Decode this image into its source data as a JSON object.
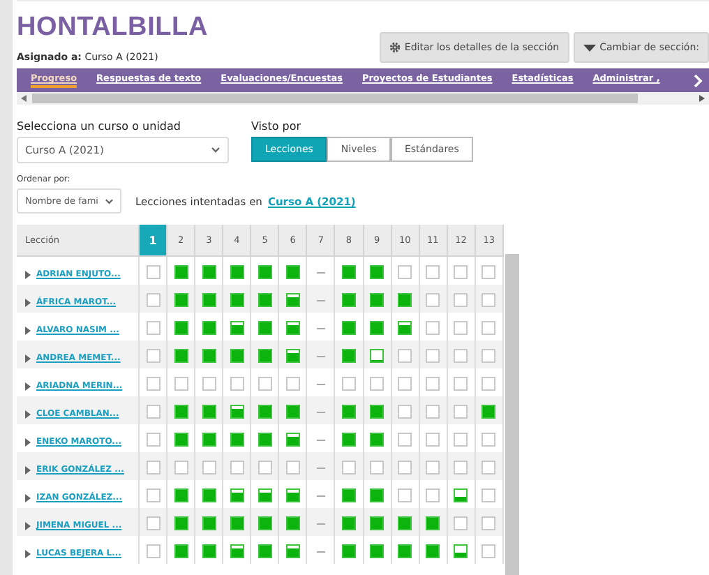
{
  "title": "HONTALBILLA",
  "assigned": {
    "label": "Asignado a:",
    "value": "Curso A (2021)"
  },
  "buttons": [
    {
      "kind": "gear",
      "label": "Editar los detalles de la sección"
    },
    {
      "kind": "caret",
      "label": "Cambiar de sección:"
    }
  ],
  "tabs": [
    {
      "label": "Progreso",
      "selected": true
    },
    {
      "label": "Respuestas de texto",
      "selected": false
    },
    {
      "label": "Evaluaciones/Encuestas",
      "selected": false
    },
    {
      "label": "Proyectos de Estudiantes",
      "selected": false
    },
    {
      "label": "Estadísticas",
      "selected": false
    },
    {
      "label": "Administrar ,",
      "selected": false
    }
  ],
  "course_select": {
    "label": "Selecciona un curso o unidad",
    "value": "Curso A (2021)"
  },
  "view_by": {
    "label": "Visto por",
    "options": [
      {
        "label": "Lecciones",
        "selected": true
      },
      {
        "label": "Niveles",
        "selected": false
      },
      {
        "label": "Estándares",
        "selected": false
      }
    ]
  },
  "sort": {
    "label": "Ordenar por:",
    "value": "Nombre de fami"
  },
  "attempted": {
    "text": "Lecciones intentadas en",
    "link": "Curso A (2021)"
  },
  "table": {
    "first_column": "Lección",
    "lessons": [
      {
        "label": "1",
        "selected": true
      },
      {
        "label": "2",
        "selected": false
      },
      {
        "label": "3",
        "selected": false
      },
      {
        "label": "4",
        "selected": false
      },
      {
        "label": "5",
        "selected": false
      },
      {
        "label": "6",
        "selected": false
      },
      {
        "label": "7",
        "selected": false
      },
      {
        "label": "8",
        "selected": false
      },
      {
        "label": "9",
        "selected": false
      },
      {
        "label": "10",
        "selected": false
      },
      {
        "label": "11",
        "selected": false
      },
      {
        "label": "12",
        "selected": false
      },
      {
        "label": "13",
        "selected": false
      }
    ],
    "rows": [
      {
        "name": "ADRIAN ENJUTO...",
        "cells": [
          {
            "kind": "empty"
          },
          {
            "kind": "full"
          },
          {
            "kind": "full"
          },
          {
            "kind": "full"
          },
          {
            "kind": "full"
          },
          {
            "kind": "full"
          },
          {
            "kind": "dash"
          },
          {
            "kind": "full"
          },
          {
            "kind": "full"
          },
          {
            "kind": "empty"
          },
          {
            "kind": "empty"
          },
          {
            "kind": "empty"
          },
          {
            "kind": "empty"
          }
        ]
      },
      {
        "name": "ÁFRICA MAROT...",
        "cells": [
          {
            "kind": "empty"
          },
          {
            "kind": "full"
          },
          {
            "kind": "full"
          },
          {
            "kind": "full"
          },
          {
            "kind": "full"
          },
          {
            "kind": "high"
          },
          {
            "kind": "dash"
          },
          {
            "kind": "full"
          },
          {
            "kind": "full"
          },
          {
            "kind": "full"
          },
          {
            "kind": "empty"
          },
          {
            "kind": "empty"
          },
          {
            "kind": "empty"
          }
        ]
      },
      {
        "name": "ALVARO NASIM ...",
        "cells": [
          {
            "kind": "empty"
          },
          {
            "kind": "full"
          },
          {
            "kind": "full"
          },
          {
            "kind": "high"
          },
          {
            "kind": "full"
          },
          {
            "kind": "high"
          },
          {
            "kind": "dash"
          },
          {
            "kind": "full"
          },
          {
            "kind": "full"
          },
          {
            "kind": "high"
          },
          {
            "kind": "empty"
          },
          {
            "kind": "empty"
          },
          {
            "kind": "empty"
          }
        ]
      },
      {
        "name": "ANDREA MEMET...",
        "cells": [
          {
            "kind": "empty"
          },
          {
            "kind": "full"
          },
          {
            "kind": "full"
          },
          {
            "kind": "full"
          },
          {
            "kind": "full"
          },
          {
            "kind": "high"
          },
          {
            "kind": "dash"
          },
          {
            "kind": "full"
          },
          {
            "kind": "low"
          },
          {
            "kind": "empty"
          },
          {
            "kind": "empty"
          },
          {
            "kind": "empty"
          },
          {
            "kind": "empty"
          }
        ]
      },
      {
        "name": "ARIADNA MERIN...",
        "cells": [
          {
            "kind": "empty"
          },
          {
            "kind": "empty"
          },
          {
            "kind": "empty"
          },
          {
            "kind": "empty"
          },
          {
            "kind": "empty"
          },
          {
            "kind": "empty"
          },
          {
            "kind": "dash"
          },
          {
            "kind": "empty"
          },
          {
            "kind": "empty"
          },
          {
            "kind": "empty"
          },
          {
            "kind": "empty"
          },
          {
            "kind": "empty"
          },
          {
            "kind": "empty"
          }
        ]
      },
      {
        "name": "CLOE CAMBLAN...",
        "cells": [
          {
            "kind": "empty"
          },
          {
            "kind": "full"
          },
          {
            "kind": "full"
          },
          {
            "kind": "high"
          },
          {
            "kind": "full"
          },
          {
            "kind": "full"
          },
          {
            "kind": "dash"
          },
          {
            "kind": "full"
          },
          {
            "kind": "full"
          },
          {
            "kind": "empty"
          },
          {
            "kind": "empty"
          },
          {
            "kind": "empty"
          },
          {
            "kind": "full"
          }
        ]
      },
      {
        "name": "ENEKO MAROTO...",
        "cells": [
          {
            "kind": "empty"
          },
          {
            "kind": "full"
          },
          {
            "kind": "full"
          },
          {
            "kind": "full"
          },
          {
            "kind": "full"
          },
          {
            "kind": "high"
          },
          {
            "kind": "dash"
          },
          {
            "kind": "full"
          },
          {
            "kind": "full"
          },
          {
            "kind": "empty"
          },
          {
            "kind": "empty"
          },
          {
            "kind": "empty"
          },
          {
            "kind": "empty"
          }
        ]
      },
      {
        "name": "ERIK GONZÁLEZ ...",
        "cells": [
          {
            "kind": "empty"
          },
          {
            "kind": "empty"
          },
          {
            "kind": "empty"
          },
          {
            "kind": "empty"
          },
          {
            "kind": "empty"
          },
          {
            "kind": "empty"
          },
          {
            "kind": "dash"
          },
          {
            "kind": "empty"
          },
          {
            "kind": "empty"
          },
          {
            "kind": "empty"
          },
          {
            "kind": "empty"
          },
          {
            "kind": "empty"
          },
          {
            "kind": "empty"
          }
        ]
      },
      {
        "name": "IZAN GONZÁLEZ...",
        "cells": [
          {
            "kind": "empty"
          },
          {
            "kind": "full"
          },
          {
            "kind": "full"
          },
          {
            "kind": "high"
          },
          {
            "kind": "high"
          },
          {
            "kind": "high"
          },
          {
            "kind": "dash"
          },
          {
            "kind": "full"
          },
          {
            "kind": "full"
          },
          {
            "kind": "empty"
          },
          {
            "kind": "empty"
          },
          {
            "kind": "half"
          },
          {
            "kind": "empty"
          }
        ]
      },
      {
        "name": "JIMENA MIGUEL ...",
        "cells": [
          {
            "kind": "empty"
          },
          {
            "kind": "full"
          },
          {
            "kind": "full"
          },
          {
            "kind": "full"
          },
          {
            "kind": "full"
          },
          {
            "kind": "full"
          },
          {
            "kind": "dash"
          },
          {
            "kind": "full"
          },
          {
            "kind": "full"
          },
          {
            "kind": "full"
          },
          {
            "kind": "full"
          },
          {
            "kind": "empty"
          },
          {
            "kind": "empty"
          }
        ]
      },
      {
        "name": "LUCAS BEJERA L...",
        "cells": [
          {
            "kind": "empty"
          },
          {
            "kind": "full"
          },
          {
            "kind": "full"
          },
          {
            "kind": "high"
          },
          {
            "kind": "full"
          },
          {
            "kind": "high"
          },
          {
            "kind": "dash"
          },
          {
            "kind": "full"
          },
          {
            "kind": "full"
          },
          {
            "kind": "full"
          },
          {
            "kind": "full"
          },
          {
            "kind": "half"
          },
          {
            "kind": "empty"
          }
        ]
      }
    ]
  }
}
